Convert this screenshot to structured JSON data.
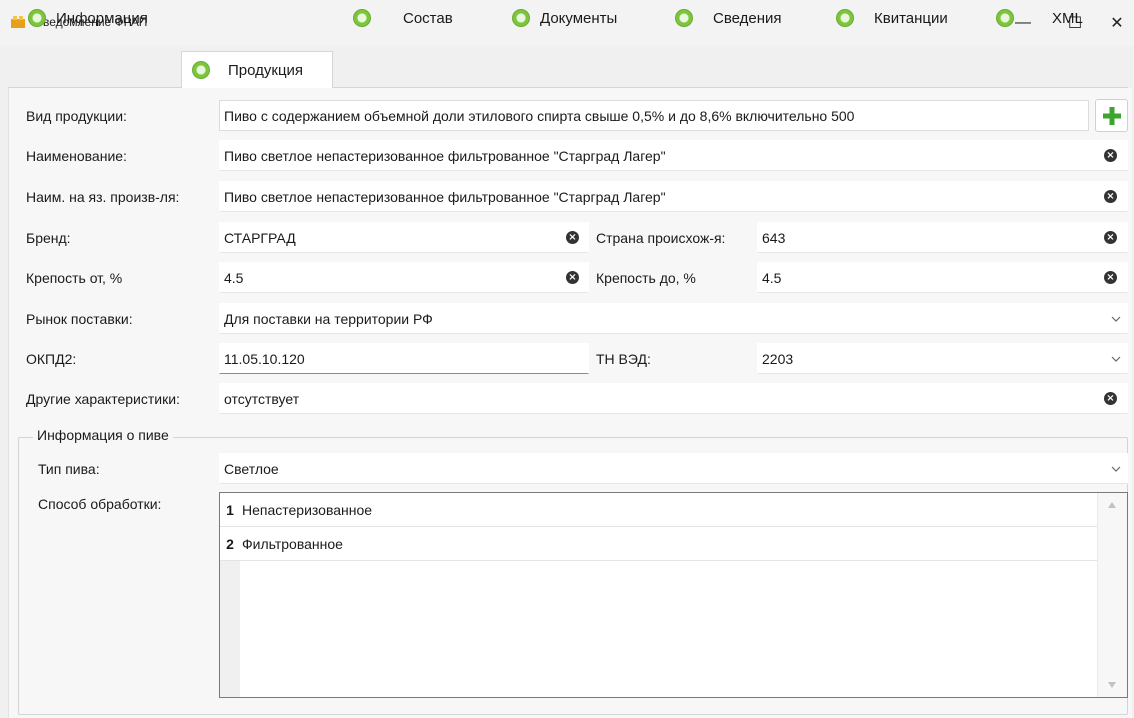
{
  "window": {
    "title": "Уведомление ФРАП",
    "minimize": "—",
    "maximize": "☐",
    "close": "✕"
  },
  "tabs": [
    {
      "label": "Информация",
      "active": false
    },
    {
      "label": "Продукция",
      "active": true
    },
    {
      "label": "Состав",
      "active": false
    },
    {
      "label": "Документы",
      "active": false
    },
    {
      "label": "Сведения",
      "active": false
    },
    {
      "label": "Квитанции",
      "active": false
    },
    {
      "label": "XML",
      "active": false
    }
  ],
  "form": {
    "product_type": {
      "label": "Вид продукции:",
      "value": "Пиво с содержанием объемной доли этилового спирта свыше 0,5% и до 8,6% включительно 500"
    },
    "name": {
      "label": "Наименование:",
      "value": "Пиво светлое непастеризованное фильтрованное \"Старград Лагер\""
    },
    "name_producer_lang": {
      "label": "Наим. на яз. произв-ля:",
      "value": "Пиво светлое непастеризованное фильтрованное \"Старград Лагер\""
    },
    "brand": {
      "label": "Бренд:",
      "value": "СТАРГРАД"
    },
    "country": {
      "label": "Страна происхож-я:",
      "value": "643"
    },
    "strength_from": {
      "label": "Крепость от, %",
      "value": "4.5"
    },
    "strength_to": {
      "label": "Крепость до, %",
      "value": "4.5"
    },
    "market": {
      "label": "Рынок поставки:",
      "value": "Для поставки на территории РФ"
    },
    "okpd2": {
      "label": "ОКПД2:",
      "value": "11.05.10.120"
    },
    "tnved": {
      "label": "ТН ВЭД:",
      "value": "2203"
    },
    "other": {
      "label": "Другие характеристики:",
      "value": "отсутствует"
    }
  },
  "beer_info": {
    "title": "Информация о пиве",
    "beer_type": {
      "label": "Тип пива:",
      "value": "Светлое"
    },
    "processing": {
      "label": "Способ обработки:",
      "items": [
        {
          "num": "1",
          "text": "Непастеризованное"
        },
        {
          "num": "2",
          "text": "Фильтрованное"
        }
      ]
    }
  },
  "colors": {
    "accent_green": "#3aa62b",
    "tab_dot": "#7cc53d"
  }
}
